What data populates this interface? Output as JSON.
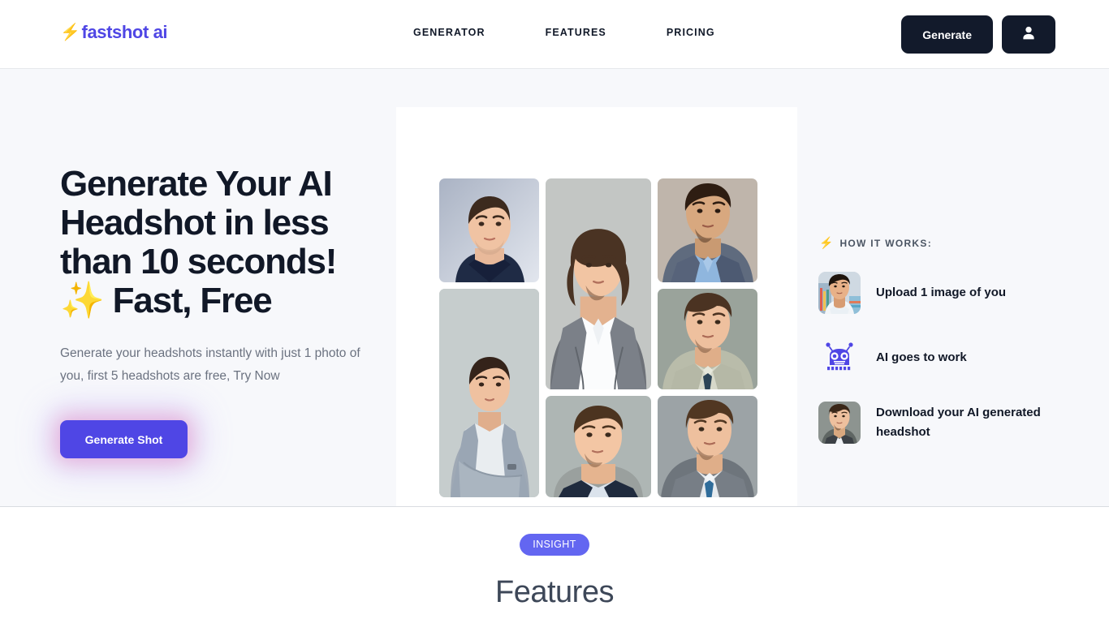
{
  "brand": {
    "bolt_icon": "⚡",
    "name": "fastshot ai",
    "accent_color": "#4f46e5",
    "bolt_color": "#f59e0b"
  },
  "nav": {
    "items": [
      {
        "label": "GENERATOR"
      },
      {
        "label": "FEATURES"
      },
      {
        "label": "PRICING"
      }
    ]
  },
  "header": {
    "generate_label": "Generate",
    "account_icon": "user-icon",
    "button_color": "#121a2b"
  },
  "hero": {
    "headline_line1": "Generate Your AI",
    "headline_line2": "Headshot in less",
    "headline_line3": "than 10 seconds!",
    "headline_sparkle": "✨",
    "headline_line4": "Fast, Free",
    "subhead": "Generate your headshots instantly with just 1 photo of you, first 5 headshots are free, Try Now",
    "cta_label": "Generate Shot",
    "cta_color": "#4f46e5",
    "background": "#f7f8fb"
  },
  "gallery": {
    "photos": [
      {
        "alt": "headshot-man-dark-suit-blue-backdrop"
      },
      {
        "alt": "headshot-man-grey-blazer-arms-crossed"
      },
      {
        "alt": "headshot-man-long-hair-grey-suit"
      },
      {
        "alt": "headshot-man-short-hair-dark-suit"
      },
      {
        "alt": "headshot-man-blue-shirt-grey-suit"
      },
      {
        "alt": "headshot-man-beige-suit-navy-tie"
      },
      {
        "alt": "headshot-man-grey-suit-blue-tie"
      }
    ]
  },
  "how_it_works": {
    "bolt_icon": "⚡",
    "title": "HOW IT WORKS:",
    "steps": [
      {
        "label": "Upload 1 image of you",
        "icon": "photo-thumbnail"
      },
      {
        "label": "AI goes to work",
        "icon": "robot-icon"
      },
      {
        "label": "Download your AI generated headshot",
        "icon": "photo-thumbnail"
      }
    ]
  },
  "features_section": {
    "badge": "INSIGHT",
    "badge_color": "#6366f1",
    "title": "Features"
  }
}
